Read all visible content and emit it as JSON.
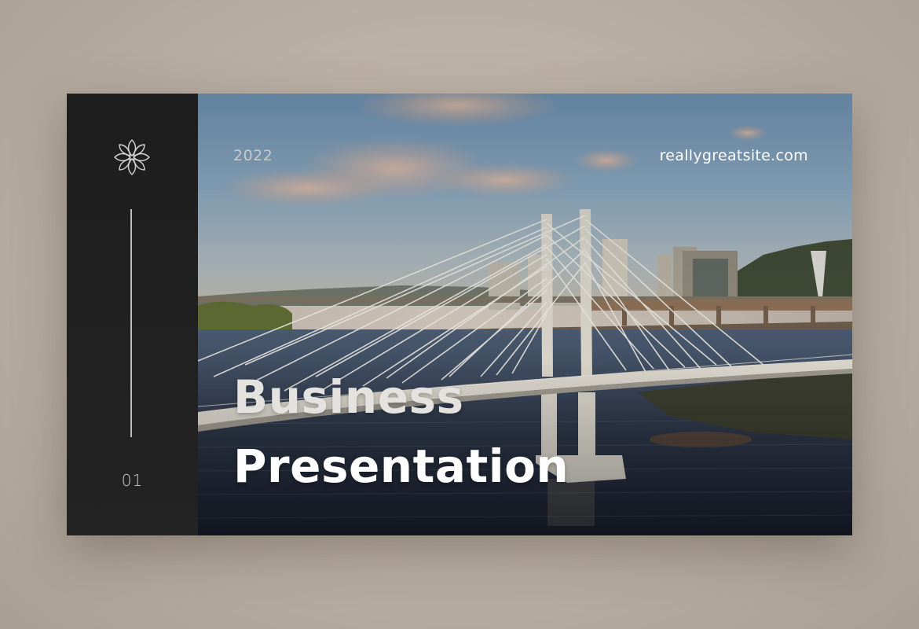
{
  "slide": {
    "year": "2022",
    "website": "reallygreatsite.com",
    "title_line1": "Business",
    "title_line2": "Presentation",
    "page_number": "01"
  },
  "icons": {
    "logo": "lotus-flower-icon"
  },
  "colors": {
    "sidebar": "#1f1f1f",
    "background": "#bdb2a7",
    "title_text": "#ffffff"
  }
}
